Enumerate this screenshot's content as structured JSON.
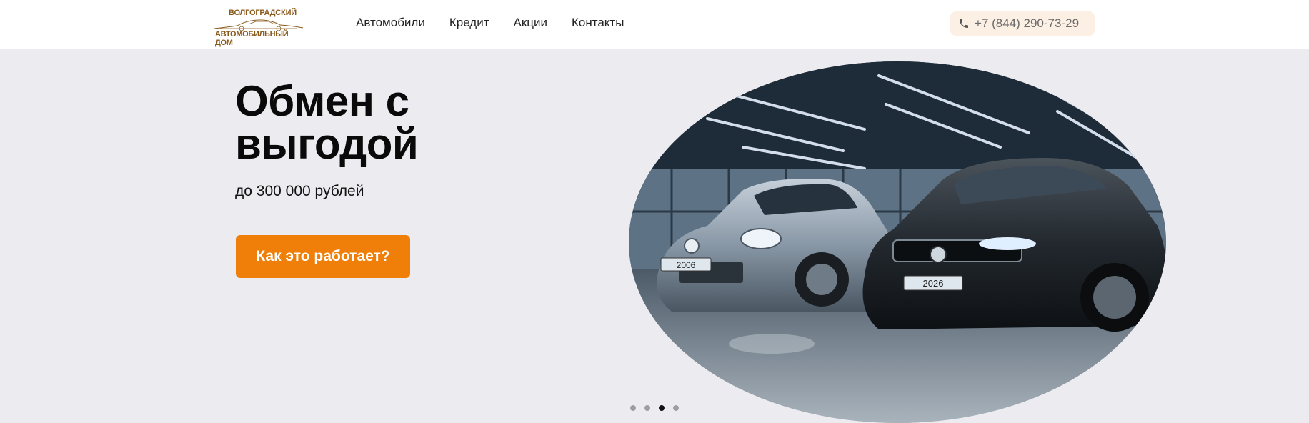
{
  "header": {
    "logo": {
      "line1": "ВОЛГОГРАДСКИЙ",
      "line2": "АВТОМОБИЛЬНЫЙ ДОМ",
      "color": "#8a5a1c"
    },
    "nav": [
      {
        "label": "Автомобили"
      },
      {
        "label": "Кредит"
      },
      {
        "label": "Акции"
      },
      {
        "label": "Контакты"
      }
    ],
    "phone": {
      "icon": "phone-icon",
      "number": "+7 (844) 290-73-29",
      "bg": "#fcefe4"
    }
  },
  "hero": {
    "title_line1": "Обмен с",
    "title_line2": "выгодой",
    "subtitle": "до 300 000 рублей",
    "cta_label": "Как это работает?",
    "cta_color": "#f07f0a",
    "image": {
      "left_car_plate": "2006",
      "right_car_plate": "2026"
    }
  },
  "carousel": {
    "total": 4,
    "active": 3
  }
}
